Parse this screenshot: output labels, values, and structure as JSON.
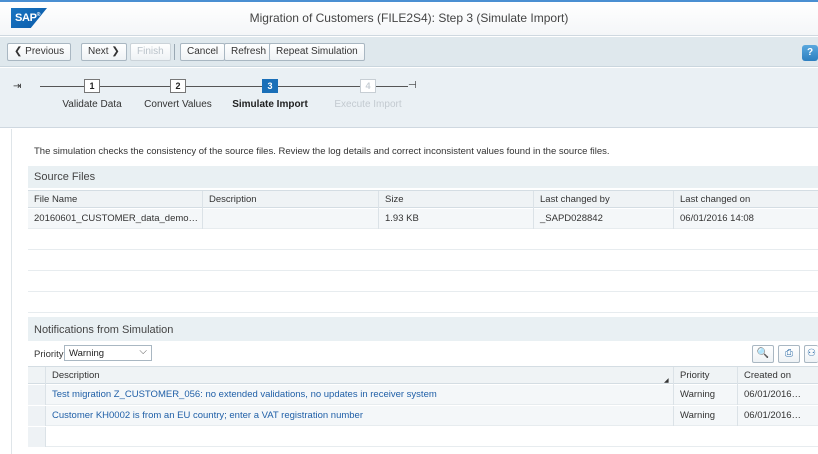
{
  "app": {
    "logo_text": "SAP",
    "title": "Migration of Customers (FILE2S4): Step 3  (Simulate Import)"
  },
  "toolbar": {
    "previous": "❮ Previous",
    "next": "Next ❯",
    "finish": "Finish",
    "cancel": "Cancel",
    "refresh": "Refresh",
    "repeat": "Repeat Simulation",
    "help": "?"
  },
  "roadmap": {
    "steps": [
      {
        "num": "1",
        "label": "Validate Data",
        "state": "done"
      },
      {
        "num": "2",
        "label": "Convert Values",
        "state": "done"
      },
      {
        "num": "3",
        "label": "Simulate Import",
        "state": "active"
      },
      {
        "num": "4",
        "label": "Execute Import",
        "state": "inactive"
      }
    ]
  },
  "info_text": "The simulation checks the consistency of the source files. Review the log details and correct inconsistent values found in the source files.",
  "source_files": {
    "heading": "Source Files",
    "columns": [
      "File Name",
      "Description",
      "Size",
      "Last changed by",
      "Last changed on"
    ],
    "rows": [
      {
        "file": "20160601_CUSTOMER_data_demo…",
        "description": "",
        "size": "1.93 KB",
        "changed_by": "_SAPD028842",
        "changed_on": "06/01/2016 14:08"
      }
    ]
  },
  "notifications": {
    "heading": "Notifications from Simulation",
    "priority_label": "Priority:",
    "priority_value": "Warning",
    "columns": [
      "Description",
      "Priority",
      "Created on"
    ],
    "rows": [
      {
        "description": "Test migration Z_CUSTOMER_056: no extended validations, no updates in receiver system",
        "priority": "Warning",
        "created": "06/01/2016…"
      },
      {
        "description": "Customer KH0002 is from an EU country; enter a VAT registration number",
        "priority": "Warning",
        "created": "06/01/2016…"
      }
    ]
  },
  "colors": {
    "accent": "#1a6fb8",
    "link": "#1f5fa7",
    "header_bg": "#e9f0f3"
  }
}
